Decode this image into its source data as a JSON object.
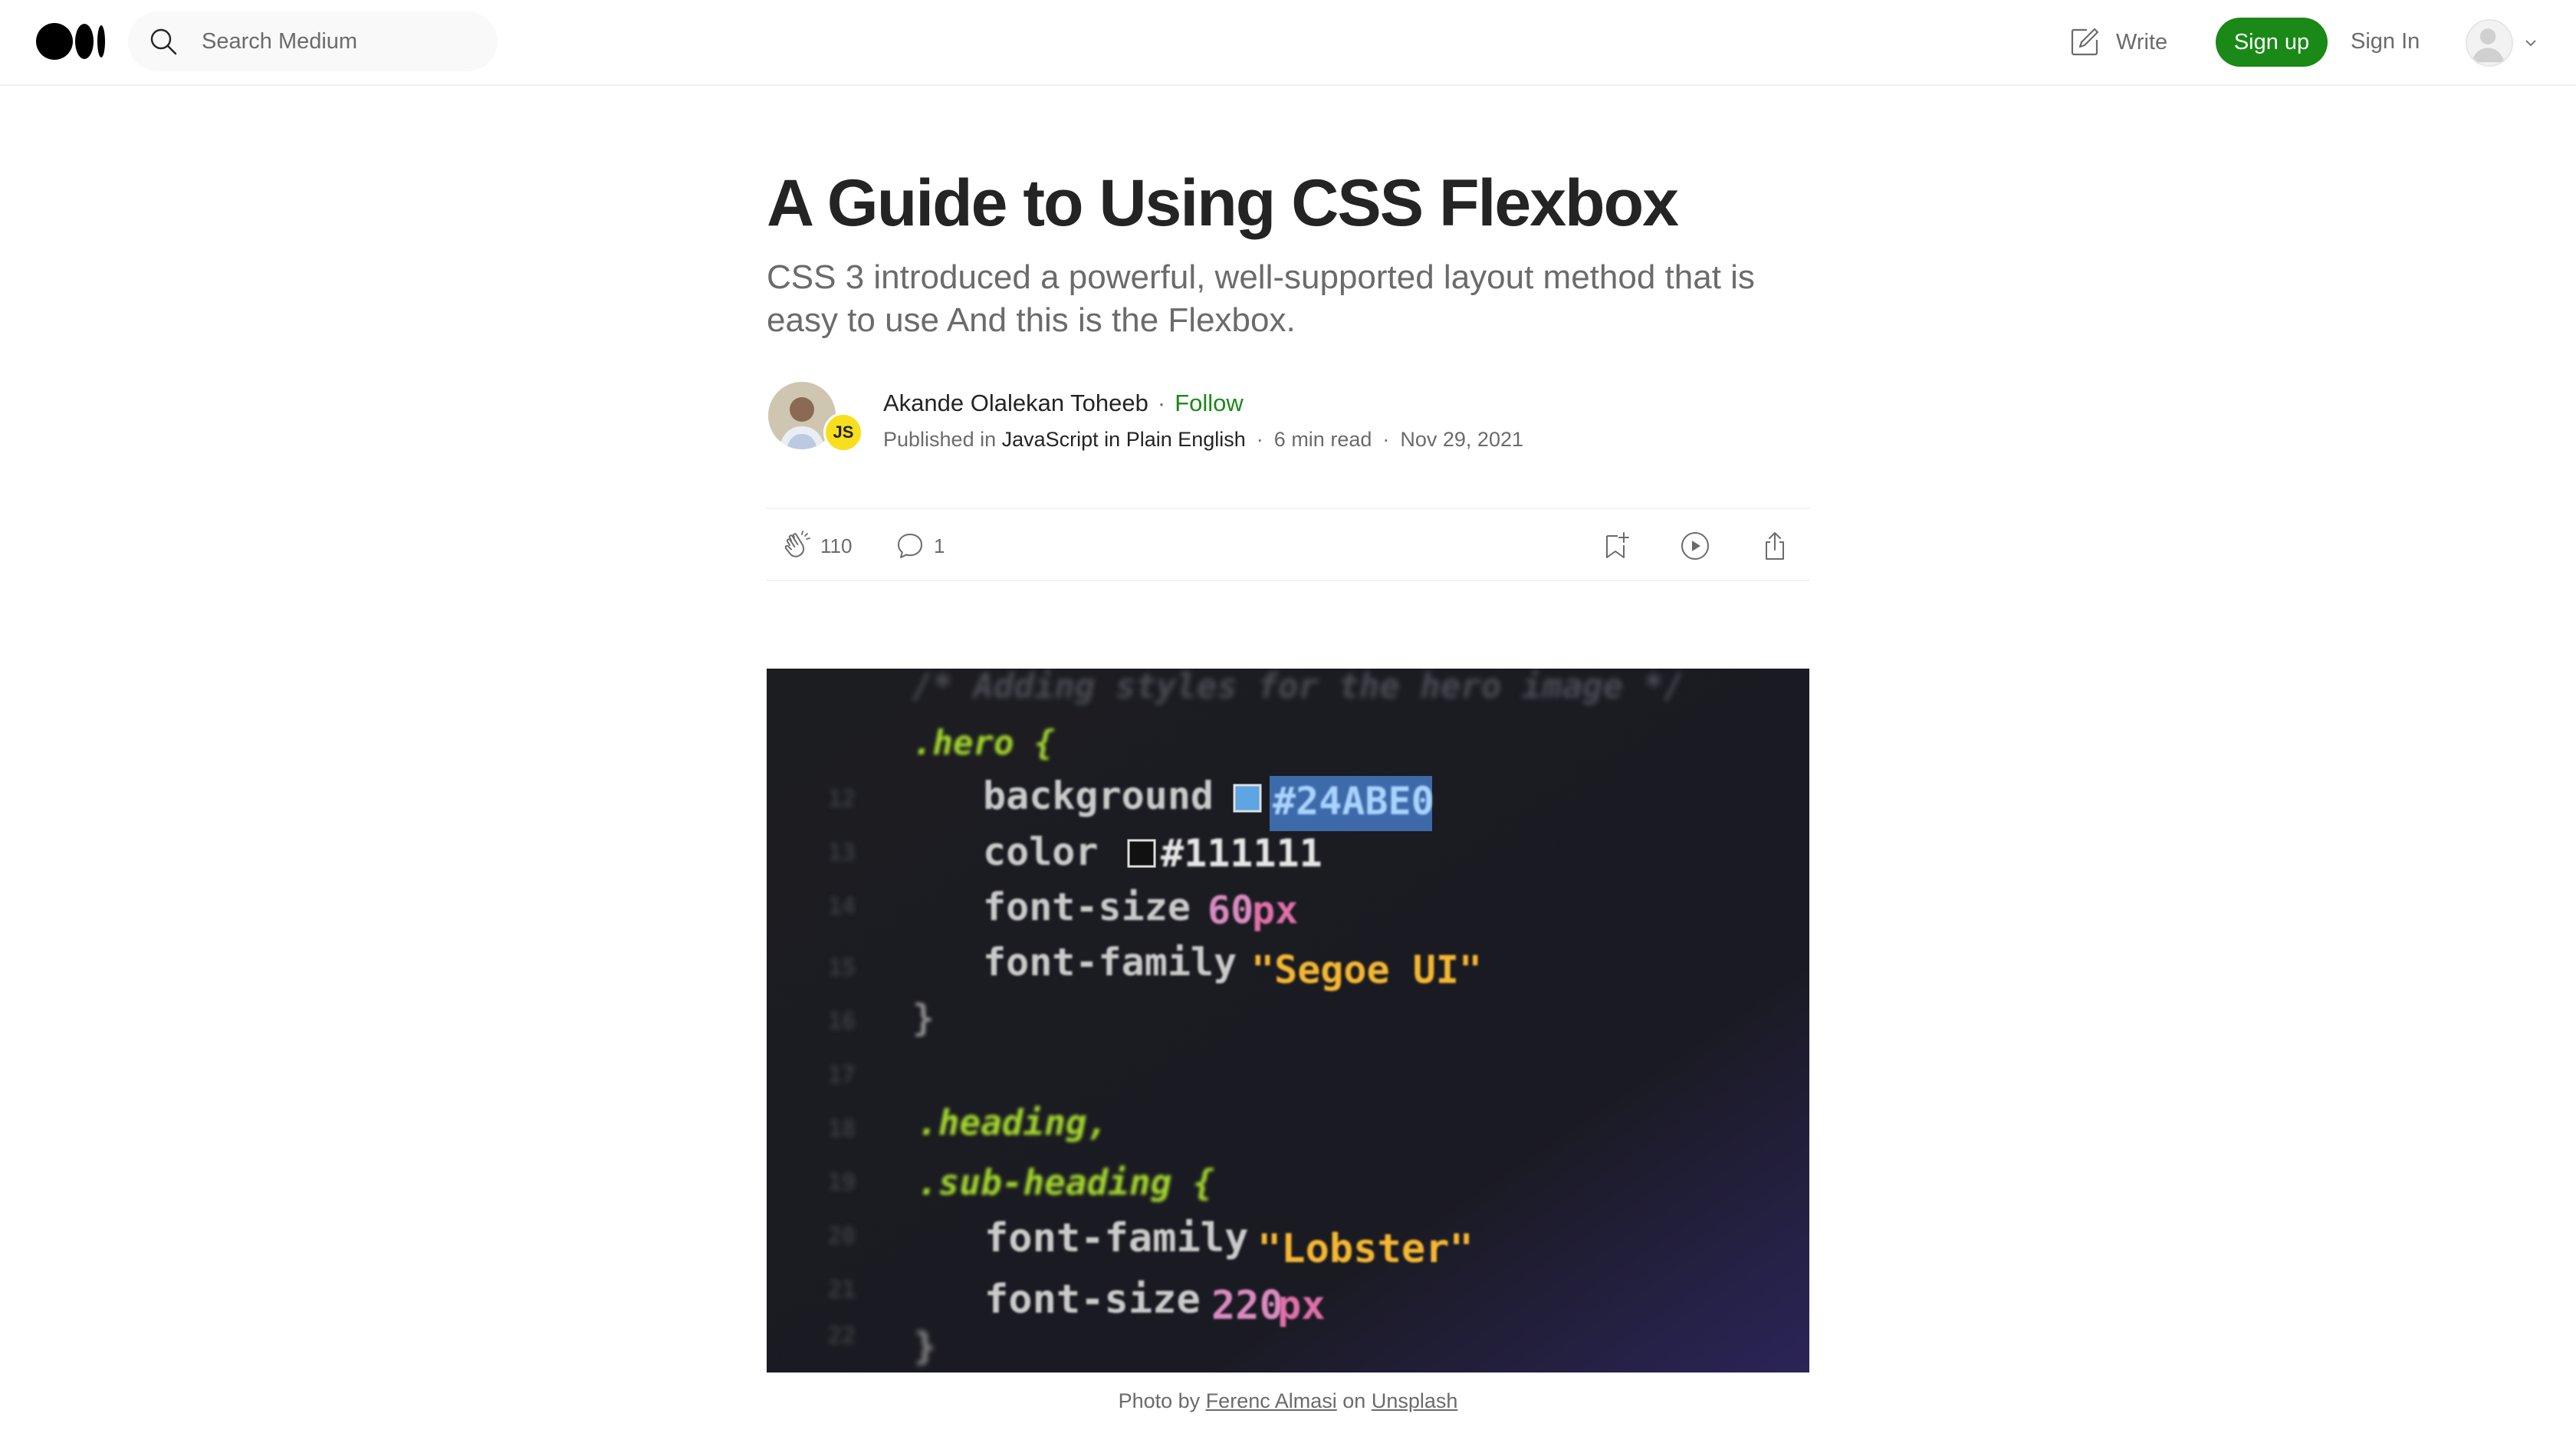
{
  "nav": {
    "search_placeholder": "Search Medium",
    "write_label": "Write",
    "signup_label": "Sign up",
    "signin_label": "Sign In"
  },
  "article": {
    "title": "A Guide to Using CSS Flexbox",
    "subtitle": "CSS 3 introduced a powerful, well-supported layout method that is easy to use And this is the Flexbox.",
    "author": "Akande Olalekan Toheeb",
    "follow_label": "Follow",
    "published_in_label": "Published in",
    "publication": "JavaScript in Plain English",
    "publication_badge": "JS",
    "read_time": "6 min read",
    "date": "Nov 29, 2021"
  },
  "actions": {
    "claps": "110",
    "comments": "1"
  },
  "image": {
    "code_lines": [
      "/* Adding styles for the hero image */",
      ".hero {",
      "background",
      "#24ABE0",
      "color",
      "#111111",
      "font-size",
      "60",
      "px",
      "font-family",
      "\"Segoe UI\"",
      "}",
      ".heading,",
      ".sub-heading {",
      "font-family",
      "\"Lobster\"",
      "font-size",
      "220",
      "px",
      "}"
    ]
  },
  "caption": {
    "prefix": "Photo by",
    "photographer": "Ferenc Almasi",
    "on": "on",
    "source": "Unsplash"
  },
  "colors": {
    "accent": "#1a8917",
    "code_green": "#a6d92e",
    "code_orange": "#f5b731",
    "code_pink": "#e06fa8",
    "code_blue": "#24ABE0"
  }
}
